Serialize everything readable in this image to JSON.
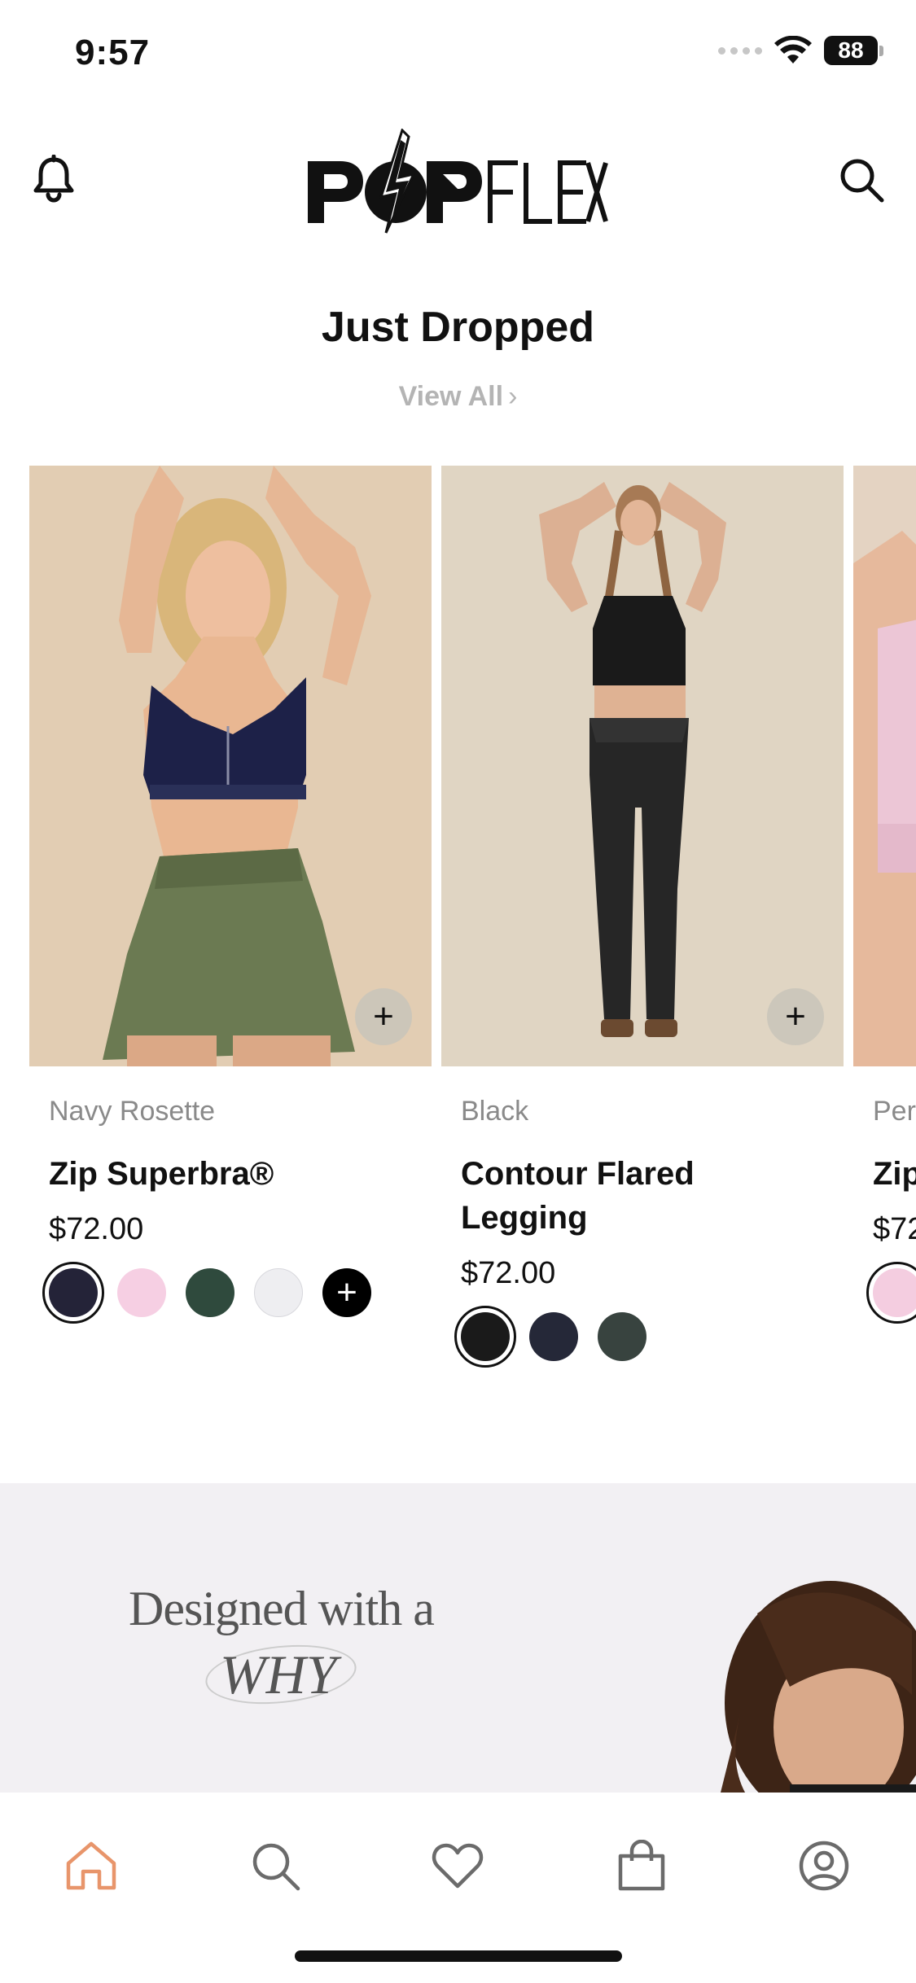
{
  "status_bar": {
    "time": "9:57",
    "battery": "88"
  },
  "header": {
    "logo_text": "POPFLEX"
  },
  "section": {
    "title": "Just Dropped",
    "view_all": "View All",
    "view_all_chevron": "›"
  },
  "products": [
    {
      "color_name": "Navy Rosette",
      "name": "Zip Superbra®",
      "price": "$72.00",
      "swatches": [
        "#242338",
        "#f6cfe3",
        "#2f4a3d",
        "#eeeef1"
      ],
      "swatch_more": "+"
    },
    {
      "color_name": "Black",
      "name": "Contour Flared Legging",
      "price": "$72.00",
      "swatches": [
        "#1a1a1a",
        "#252838",
        "#38433f"
      ]
    },
    {
      "color_name": "Per",
      "name": "Zip",
      "price": "$72",
      "swatches": [
        "#f4cde0"
      ]
    }
  ],
  "quick_add_label": "+",
  "banner": {
    "line1": "Designed with a",
    "line2": "WHY"
  },
  "tab_bar": {
    "items": [
      "home-icon",
      "search-icon",
      "heart-icon",
      "bag-icon",
      "profile-icon"
    ],
    "active_color": "#e8956b",
    "inactive_color": "#6b6b6b"
  }
}
